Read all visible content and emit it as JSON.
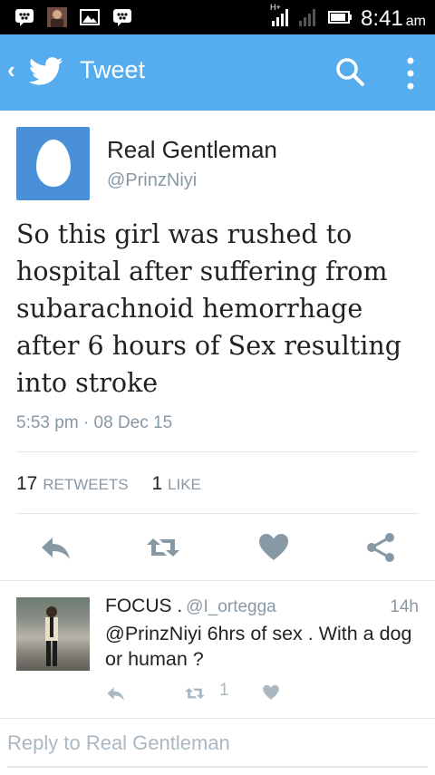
{
  "status_bar": {
    "time": "8:41",
    "ampm": "am",
    "icons": [
      "bbm-icon",
      "photo-notification-icon",
      "gallery-icon",
      "bbm-icon",
      "signal-icon",
      "signal-icon",
      "battery-icon"
    ],
    "network_label": "H+"
  },
  "app_bar": {
    "back_glyph": "‹",
    "title": "Tweet",
    "icons": [
      "twitter-bird-icon",
      "search-icon",
      "more-vert-icon"
    ]
  },
  "tweet": {
    "author_name": "Real Gentleman",
    "author_handle": "@PrinzNiyi",
    "text": "So this girl was rushed to hospital after suffering from subarachnoid hemorrhage after 6 hours of Sex resulting into stroke",
    "timestamp": "5:53 pm · 08 Dec 15",
    "retweets_count": "17",
    "retweets_label": "RETWEETS",
    "likes_count": "1",
    "likes_label": "LIKE",
    "actions": [
      "reply-icon",
      "retweet-icon",
      "like-icon",
      "share-icon"
    ]
  },
  "reply": {
    "name": "FOCUS .",
    "handle": "@I_ortegga",
    "time": "14h",
    "text": "@PrinzNiyi 6hrs of sex . With a dog or human ?",
    "retweet_count": "1"
  },
  "reply_box": {
    "placeholder": "Reply to Real Gentleman"
  },
  "colors": {
    "twitter_blue": "#55acee",
    "avatar_blue": "#4a90d9",
    "gray_text": "#8899a6",
    "icon_gray": "#8899a6"
  }
}
